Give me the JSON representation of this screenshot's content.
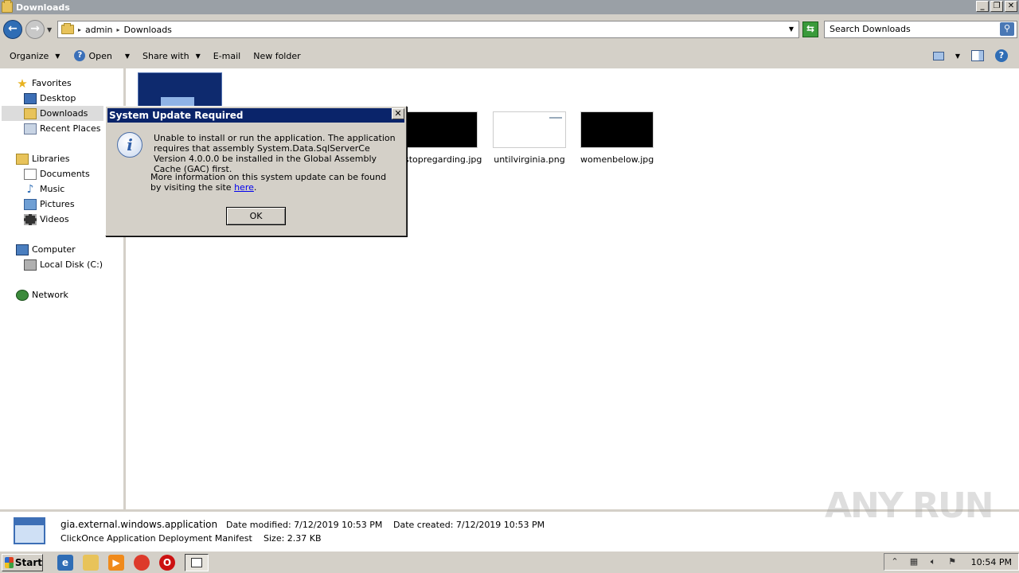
{
  "window": {
    "title": "Downloads"
  },
  "address": {
    "crumbs": [
      "admin",
      "Downloads"
    ],
    "search_placeholder": "Search Downloads"
  },
  "toolbar": {
    "organize": "Organize",
    "open": "Open",
    "share_with": "Share with",
    "email": "E-mail",
    "new_folder": "New folder"
  },
  "sidebar": {
    "favorites": "Favorites",
    "desktop": "Desktop",
    "downloads": "Downloads",
    "recent_places": "Recent Places",
    "libraries": "Libraries",
    "documents": "Documents",
    "music": "Music",
    "pictures": "Pictures",
    "videos": "Videos",
    "computer": "Computer",
    "local_disk": "Local Disk (C:)",
    "network": "Network"
  },
  "files": [
    {
      "name": "stopregarding.jpg"
    },
    {
      "name": "untilvirginia.png"
    },
    {
      "name": "womenbelow.jpg"
    }
  ],
  "dialog": {
    "title": "System Update Required",
    "message": "Unable to install or run the application. The application requires that assembly System.Data.SqlServerCe Version 4.0.0.0 be installed in the Global Assembly Cache (GAC) first.",
    "more_prefix": "More information on this system update can be found by visiting the site ",
    "link_text": "here",
    "more_suffix": ".",
    "ok_label": "OK"
  },
  "details": {
    "file_name": "gia.external.windows.application",
    "file_type": "ClickOnce Application Deployment Manifest",
    "modified_label": "Date modified:",
    "modified_value": "7/12/2019 10:53 PM",
    "created_label": "Date created:",
    "created_value": "7/12/2019 10:53 PM",
    "size_label": "Size:",
    "size_value": "2.37 KB"
  },
  "watermark": "ANY RUN",
  "taskbar": {
    "start_label": "Start",
    "clock": "10:54 PM"
  },
  "colors": {
    "dialog_title_bg": "#0a246a",
    "chrome": "#d4d0c8",
    "link": "#0000ee"
  }
}
